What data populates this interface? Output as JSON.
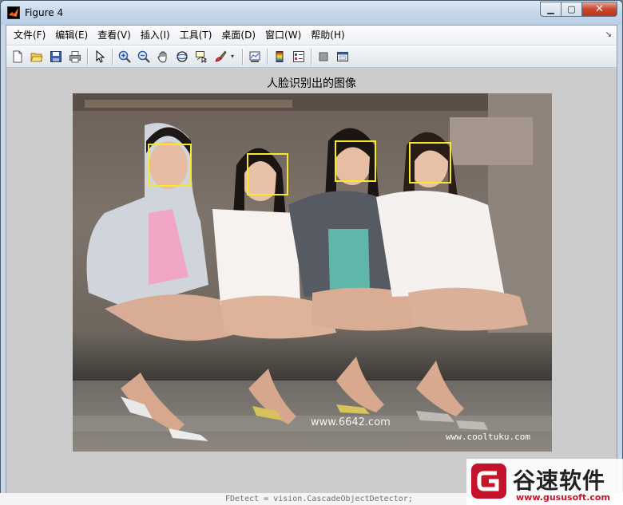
{
  "window": {
    "title": "Figure 4"
  },
  "menu": {
    "items": [
      "文件(F)",
      "编辑(E)",
      "查看(V)",
      "插入(I)",
      "工具(T)",
      "桌面(D)",
      "窗口(W)",
      "帮助(H)"
    ]
  },
  "toolbar": {
    "icons": [
      "new-figure-icon",
      "open-file-icon",
      "save-figure-icon",
      "print-figure-icon",
      "edit-plot-icon",
      "zoom-in-icon",
      "zoom-out-icon",
      "pan-icon",
      "rotate-3d-icon",
      "data-cursor-icon",
      "brush-icon",
      "link-plot-icon",
      "colorbar-icon",
      "legend-icon",
      "hide-plot-tools-icon",
      "show-plot-tools-icon"
    ]
  },
  "figure": {
    "axes_title": "人脸识别出的图像",
    "detected_faces_count": 4,
    "box_color": "#f7e82a"
  },
  "watermarks": {
    "center": "www.6642.com",
    "corner": "www.cooltuku.com"
  },
  "command_strip": {
    "text": "FDetect = vision.CascadeObjectDetector;"
  },
  "brand": {
    "name": "谷速软件",
    "url": "www.gususoft.com",
    "color": "#c3142a"
  }
}
